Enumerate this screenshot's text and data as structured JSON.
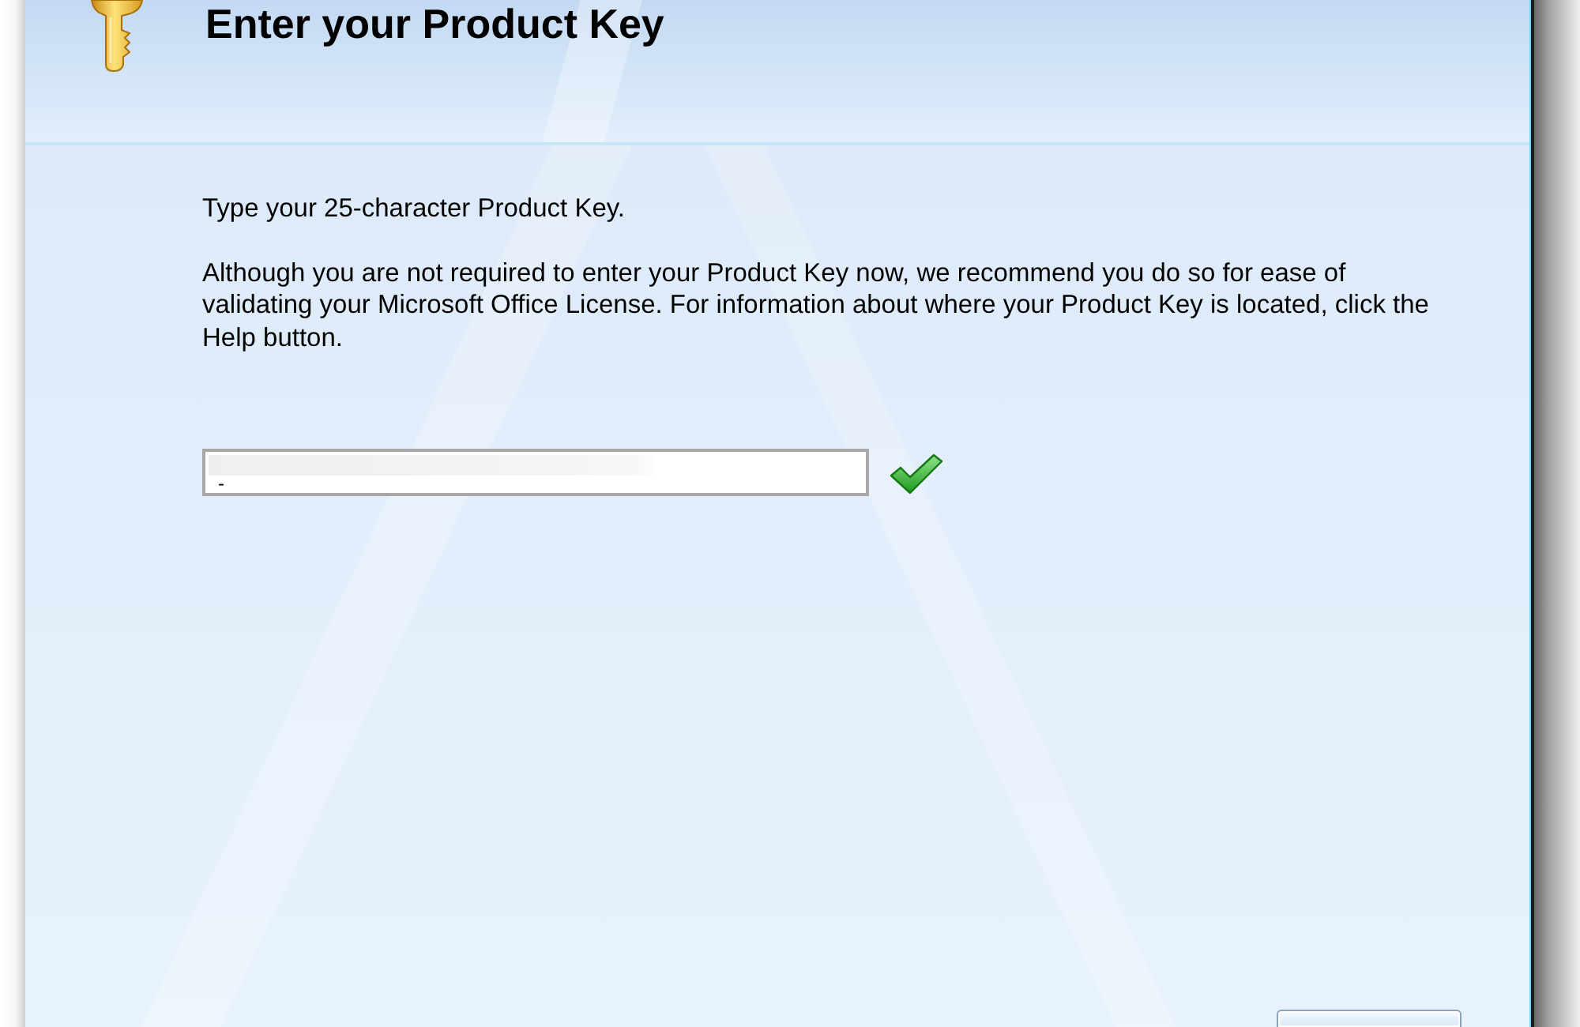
{
  "dialog": {
    "title": "Enter your Product Key",
    "instruction": "Type your 25-character Product Key.",
    "description": "Although you are not required to enter your Product Key now, we recommend you do so for ease of validating your Microsoft Office License. For information about where your Product Key is located, click the Help button.",
    "product_key": {
      "value": "-",
      "valid": true
    }
  }
}
